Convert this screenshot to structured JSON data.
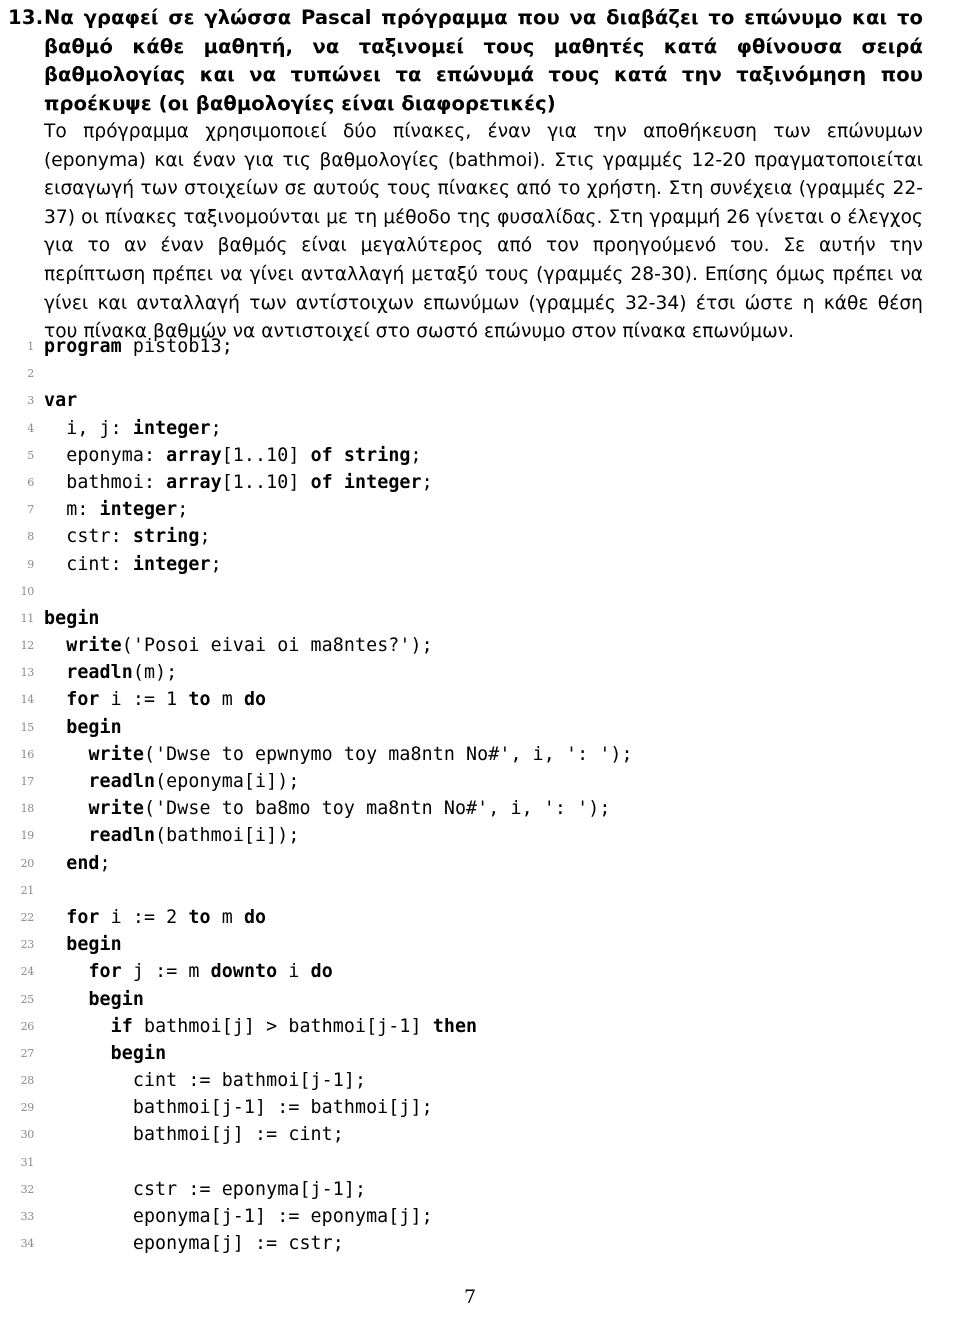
{
  "exercise": {
    "number": "13.",
    "statement": "Να γραφεί σε γλώσσα Pascal πρόγραμμα που να διαβάζει το επώνυμο και το βαθμό κάθε μαθητή, να ταξινομεί τους μαθητές κατά φθίνουσα σειρά βαθμολογίας και να τυπώνει τα επώνυμά τους κατά την ταξινόμηση που προέκυψε (οι βαθμολογίες είναι διαφορετικές)",
    "description": "Το πρόγραμμα χρησιμοποιεί δύο πίνακες, έναν για την αποθήκευση των επώνυμων (eponyma) και έναν για τις βαθμολογίες (bathmoi). Στις γραμμές 12-20 πραγματοποιείται εισαγωγή των στοιχείων σε αυτούς τους πίνακες από το χρήστη. Στη συνέχεια (γραμμές 22-37) οι πίνακες ταξινομούνται με τη μέθοδο της φυσαλίδας. Στη γραμμή 26 γίνεται ο έλεγχος για το αν έναν βαθμός είναι μεγαλύτερος από τον προηγούμενό του. Σε αυτήν την περίπτωση πρέπει να γίνει ανταλλαγή μεταξύ τους (γραμμές 28-30). Επίσης όμως πρέπει να γίνει και ανταλλαγή των αντίστοιχων επωνύμων (γραμμές 32-34) έτσι ώστε η κάθε θέση του πίνακα βαθμών να αντιστοιχεί στο σωστό επώνυμο στον πίνακα επωνύμων."
  },
  "code_listing": {
    "language": "Pascal",
    "lines": [
      {
        "n": "1",
        "text": "program pistob13;",
        "kw": [
          "program"
        ]
      },
      {
        "n": "2",
        "text": "",
        "kw": []
      },
      {
        "n": "3",
        "text": "var",
        "kw": [
          "var"
        ]
      },
      {
        "n": "4",
        "text": "  i, j: integer;",
        "kw": [
          "integer"
        ]
      },
      {
        "n": "5",
        "text": "  eponyma: array[1..10] of string;",
        "kw": [
          "array",
          "of",
          "string"
        ]
      },
      {
        "n": "6",
        "text": "  bathmoi: array[1..10] of integer;",
        "kw": [
          "array",
          "of",
          "integer"
        ]
      },
      {
        "n": "7",
        "text": "  m: integer;",
        "kw": [
          "integer"
        ]
      },
      {
        "n": "8",
        "text": "  cstr: string;",
        "kw": [
          "string"
        ]
      },
      {
        "n": "9",
        "text": "  cint: integer;",
        "kw": [
          "integer"
        ]
      },
      {
        "n": "10",
        "text": "",
        "kw": []
      },
      {
        "n": "11",
        "text": "begin",
        "kw": [
          "begin"
        ]
      },
      {
        "n": "12",
        "text": "  write('Posoi eivai oi ma8ntes?');",
        "kw": [
          "write"
        ]
      },
      {
        "n": "13",
        "text": "  readln(m);",
        "kw": [
          "readln"
        ]
      },
      {
        "n": "14",
        "text": "  for i := 1 to m do",
        "kw": [
          "for",
          "to",
          "do"
        ]
      },
      {
        "n": "15",
        "text": "  begin",
        "kw": [
          "begin"
        ]
      },
      {
        "n": "16",
        "text": "    write('Dwse to epwnymo toy ma8ntn No#', i, ': ');",
        "kw": [
          "write"
        ]
      },
      {
        "n": "17",
        "text": "    readln(eponyma[i]);",
        "kw": [
          "readln"
        ]
      },
      {
        "n": "18",
        "text": "    write('Dwse to ba8mo toy ma8ntn No#', i, ': ');",
        "kw": [
          "write"
        ]
      },
      {
        "n": "19",
        "text": "    readln(bathmoi[i]);",
        "kw": [
          "readln"
        ]
      },
      {
        "n": "20",
        "text": "  end;",
        "kw": [
          "end"
        ]
      },
      {
        "n": "21",
        "text": "",
        "kw": []
      },
      {
        "n": "22",
        "text": "  for i := 2 to m do",
        "kw": [
          "for",
          "to",
          "do"
        ]
      },
      {
        "n": "23",
        "text": "  begin",
        "kw": [
          "begin"
        ]
      },
      {
        "n": "24",
        "text": "    for j := m downto i do",
        "kw": [
          "for",
          "downto",
          "do"
        ]
      },
      {
        "n": "25",
        "text": "    begin",
        "kw": [
          "begin"
        ]
      },
      {
        "n": "26",
        "text": "      if bathmoi[j] > bathmoi[j-1] then",
        "kw": [
          "if",
          "then"
        ]
      },
      {
        "n": "27",
        "text": "      begin",
        "kw": [
          "begin"
        ]
      },
      {
        "n": "28",
        "text": "        cint := bathmoi[j-1];",
        "kw": []
      },
      {
        "n": "29",
        "text": "        bathmoi[j-1] := bathmoi[j];",
        "kw": []
      },
      {
        "n": "30",
        "text": "        bathmoi[j] := cint;",
        "kw": []
      },
      {
        "n": "31",
        "text": "",
        "kw": []
      },
      {
        "n": "32",
        "text": "        cstr := eponyma[j-1];",
        "kw": []
      },
      {
        "n": "33",
        "text": "        eponyma[j-1] := eponyma[j];",
        "kw": []
      },
      {
        "n": "34",
        "text": "        eponyma[j] := cstr;",
        "kw": []
      }
    ]
  },
  "footer": {
    "page_number": "7"
  }
}
